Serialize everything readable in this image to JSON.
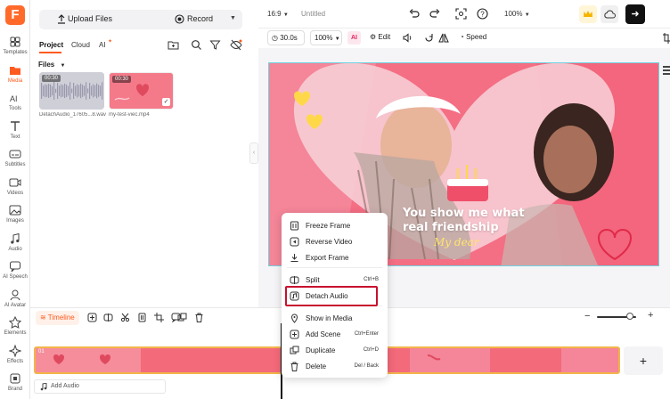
{
  "nav": {
    "items": [
      {
        "label": "Templates",
        "icon": "templates-icon"
      },
      {
        "label": "Media",
        "icon": "media-icon",
        "active": true
      },
      {
        "label": "Tools",
        "icon": "ai-tools-icon"
      },
      {
        "label": "Text",
        "icon": "text-icon"
      },
      {
        "label": "Subtitles",
        "icon": "subtitles-icon"
      },
      {
        "label": "Videos",
        "icon": "videos-icon"
      },
      {
        "label": "Images",
        "icon": "images-icon"
      },
      {
        "label": "Audio",
        "icon": "audio-icon"
      },
      {
        "label": "AI Speech",
        "icon": "ai-speech-icon"
      },
      {
        "label": "AI Avatar",
        "icon": "ai-avatar-icon"
      },
      {
        "label": "Elements",
        "icon": "elements-icon"
      },
      {
        "label": "Effects",
        "icon": "effects-icon"
      },
      {
        "label": "Brand",
        "icon": "brand-icon"
      }
    ]
  },
  "panel": {
    "upload_label": "Upload Files",
    "record_label": "Record",
    "tabs": [
      "Project",
      "Cloud",
      "AI"
    ],
    "files_label": "Files",
    "files": [
      {
        "duration": "00:30",
        "name": "DetachAudio_17605...8.wav"
      },
      {
        "duration": "00:30",
        "name": "my-test-viec.mp4"
      }
    ]
  },
  "topbar": {
    "aspect": "16:9",
    "title": "Untitled",
    "zoom": "100%"
  },
  "toolbar2": {
    "duration": "30.0s",
    "scale": "100%",
    "edit_label": "Edit",
    "speed_label": "Speed"
  },
  "canvas": {
    "headline_line1": "You show me what",
    "headline_line2": "real friendship",
    "script_text": "My dear"
  },
  "context_menu": {
    "items": [
      {
        "label": "Freeze Frame",
        "shortcut": "",
        "icon": "freeze-frame-icon"
      },
      {
        "label": "Reverse Video",
        "shortcut": "",
        "icon": "reverse-video-icon"
      },
      {
        "label": "Export Frame",
        "shortcut": "",
        "icon": "export-frame-icon"
      },
      {
        "label": "Split",
        "shortcut": "Ctrl+B",
        "icon": "split-icon"
      },
      {
        "label": "Detach Audio",
        "shortcut": "",
        "icon": "detach-audio-icon"
      },
      {
        "label": "Show in Media",
        "shortcut": "",
        "icon": "show-in-media-icon"
      },
      {
        "label": "Add Scene",
        "shortcut": "Ctrl+Enter",
        "icon": "add-scene-icon"
      },
      {
        "label": "Duplicate",
        "shortcut": "Ctrl+D",
        "icon": "duplicate-icon"
      },
      {
        "label": "Delete",
        "shortcut": "Del / Back",
        "icon": "delete-icon"
      }
    ]
  },
  "timeline": {
    "label": "Timeline",
    "track_number": "01",
    "add_audio_label": "Add Audio",
    "add_clip_symbol": "+",
    "zoom_level": 0.85
  },
  "colors": {
    "accent": "#ff5a1f",
    "highlight": "#c8102e",
    "track_border": "#f3b54a",
    "clip": "#f36a7a"
  }
}
